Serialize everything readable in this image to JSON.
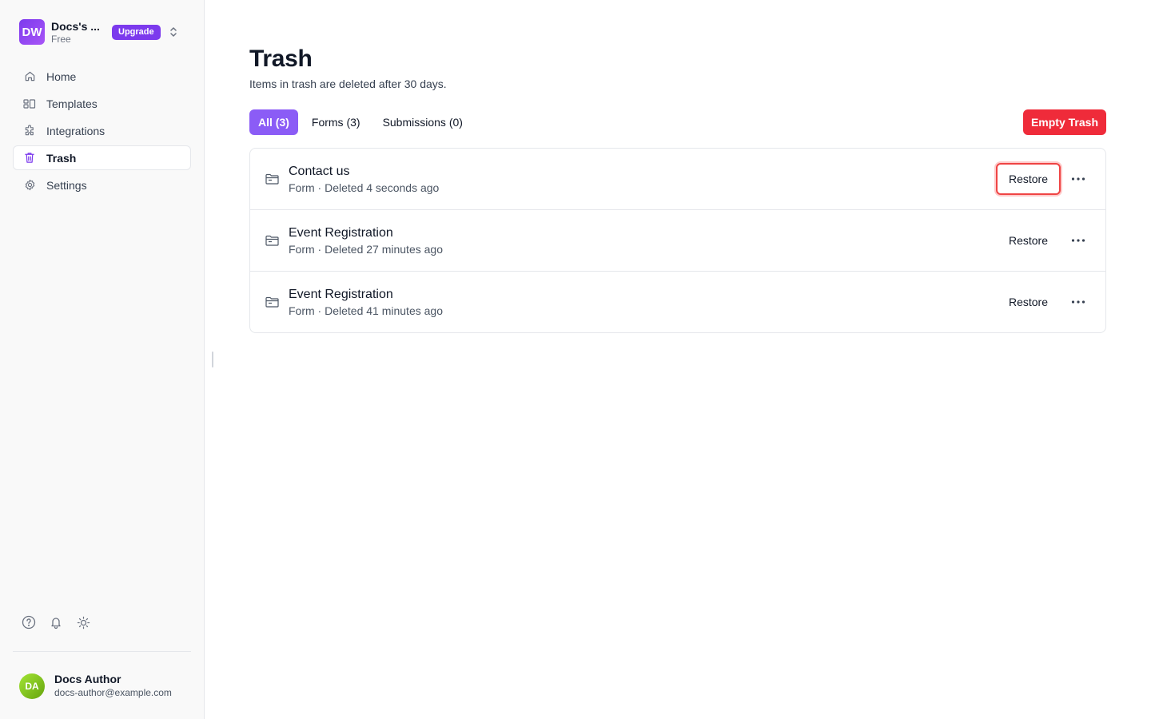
{
  "workspace": {
    "initials": "DW",
    "name": "Docs's ...",
    "plan": "Free",
    "upgrade_label": "Upgrade"
  },
  "nav": {
    "items": [
      {
        "label": "Home",
        "icon": "home-icon"
      },
      {
        "label": "Templates",
        "icon": "templates-icon"
      },
      {
        "label": "Integrations",
        "icon": "puzzle-icon"
      },
      {
        "label": "Trash",
        "icon": "trash-icon",
        "active": true
      },
      {
        "label": "Settings",
        "icon": "gear-icon"
      }
    ]
  },
  "bottom_icons": [
    "help-icon",
    "bell-icon",
    "sun-icon"
  ],
  "user": {
    "initials": "DA",
    "name": "Docs Author",
    "email": "docs-author@example.com"
  },
  "page": {
    "title": "Trash",
    "subtitle": "Items in trash are deleted after 30 days."
  },
  "tabs": [
    {
      "label": "All (3)",
      "active": true
    },
    {
      "label": "Forms (3)"
    },
    {
      "label": "Submissions (0)"
    }
  ],
  "empty_trash_label": "Empty Trash",
  "items": [
    {
      "title": "Contact us",
      "meta": "Form · Deleted 4 seconds ago",
      "restore_label": "Restore",
      "icon": "folder-icon"
    },
    {
      "title": "Event Registration",
      "meta": "Form · Deleted 27 minutes ago",
      "restore_label": "Restore",
      "icon": "folder-icon"
    },
    {
      "title": "Event Registration",
      "meta": "Form · Deleted 41 minutes ago",
      "restore_label": "Restore",
      "icon": "folder-icon"
    }
  ],
  "colors": {
    "accent": "#7c3aed",
    "tab_active": "#8b5cf6",
    "danger": "#ef2b3a"
  }
}
